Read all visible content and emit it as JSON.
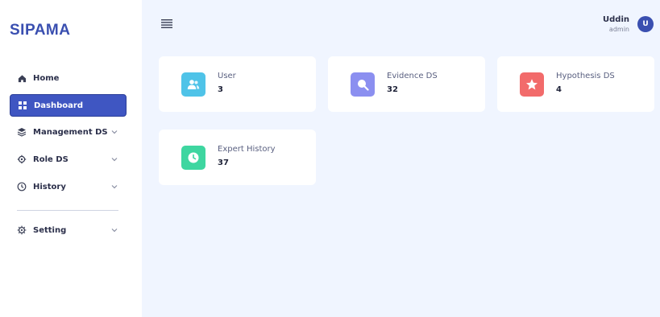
{
  "brand": "SIPAMA",
  "sidebar": {
    "items": [
      {
        "label": "Home",
        "icon": "home-icon"
      },
      {
        "label": "Dashboard",
        "icon": "grid-icon",
        "active": true
      },
      {
        "label": "Management DS",
        "icon": "layers-icon",
        "expandable": true
      },
      {
        "label": "Role DS",
        "icon": "settings-icon",
        "expandable": true
      },
      {
        "label": "History",
        "icon": "clock-icon",
        "expandable": true
      }
    ],
    "bottom_items": [
      {
        "label": "Setting",
        "icon": "gear-icon",
        "expandable": true
      }
    ]
  },
  "user": {
    "name": "Uddin",
    "role": "admin",
    "avatar_initial": "U"
  },
  "cards": [
    {
      "title": "User",
      "value": "3",
      "icon": "users-icon",
      "color": "#4fc3e8"
    },
    {
      "title": "Evidence DS",
      "value": "32",
      "icon": "search-icon",
      "color": "#8b8ff0"
    },
    {
      "title": "Hypothesis DS",
      "value": "4",
      "icon": "star-icon",
      "color": "#f26b6b"
    },
    {
      "title": "Expert History",
      "value": "37",
      "icon": "clock-icon",
      "color": "#3ed6a0"
    }
  ],
  "colors": {
    "accent": "#3f56c2",
    "background": "#f0f5ff"
  }
}
